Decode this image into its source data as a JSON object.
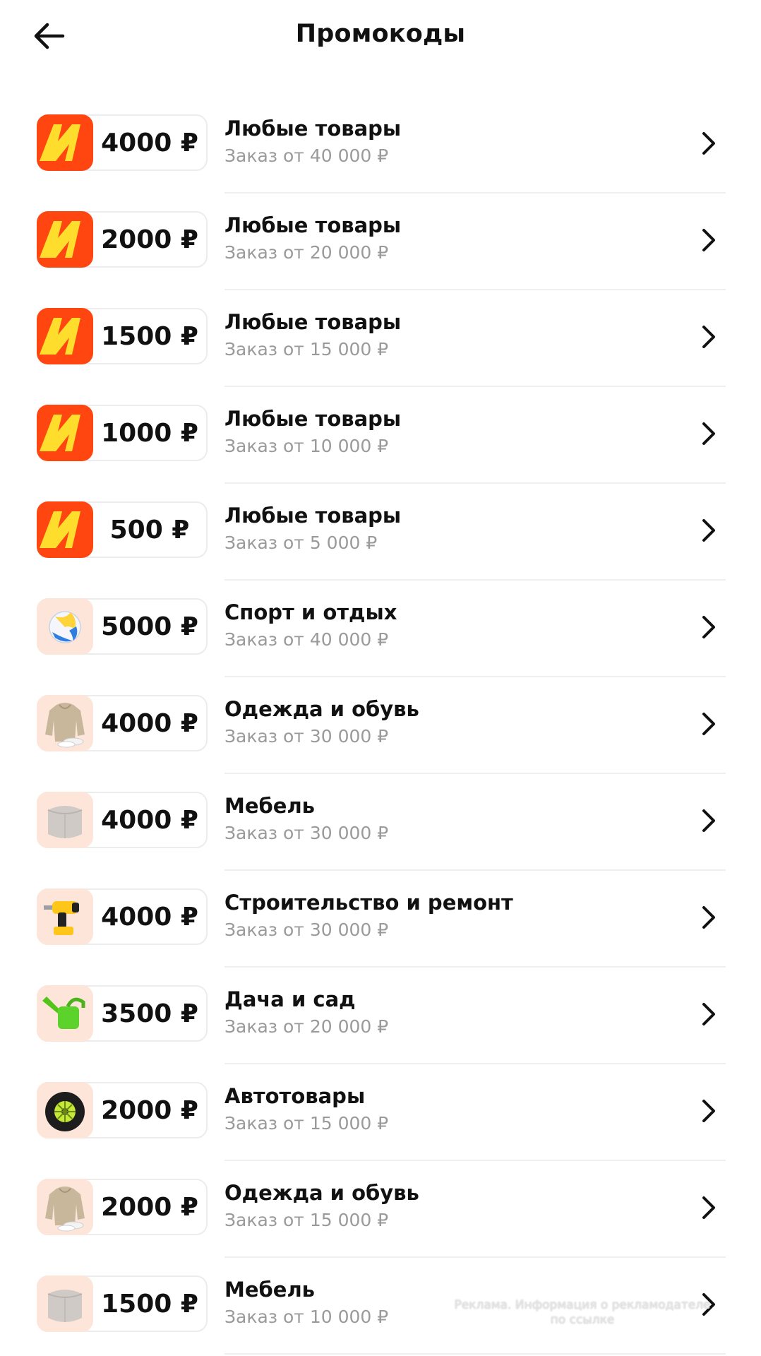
{
  "header": {
    "title": "Промокоды",
    "back_icon": "arrow-left-icon"
  },
  "colors": {
    "brand_red": "#ff4611",
    "brand_yellow": "#ffdd2d",
    "subtext": "#9a9a9a",
    "thumb_peach": "#fde6d9"
  },
  "promos": [
    {
      "amount": "4000 ₽",
      "category": "Любые товары",
      "condition": "Заказ от 40 000 ₽",
      "icon": "market-logo-icon"
    },
    {
      "amount": "2000 ₽",
      "category": "Любые товары",
      "condition": "Заказ от 20 000 ₽",
      "icon": "market-logo-icon"
    },
    {
      "amount": "1500 ₽",
      "category": "Любые товары",
      "condition": "Заказ от 15 000 ₽",
      "icon": "market-logo-icon"
    },
    {
      "amount": "1000 ₽",
      "category": "Любые товары",
      "condition": "Заказ от 10 000 ₽",
      "icon": "market-logo-icon"
    },
    {
      "amount": "500 ₽",
      "category": "Любые товары",
      "condition": "Заказ от 5 000 ₽",
      "icon": "market-logo-icon"
    },
    {
      "amount": "5000 ₽",
      "category": "Спорт и отдых",
      "condition": "Заказ от 40 000 ₽",
      "icon": "volleyball-icon"
    },
    {
      "amount": "4000 ₽",
      "category": "Одежда и обувь",
      "condition": "Заказ от 30 000 ₽",
      "icon": "hoodie-icon"
    },
    {
      "amount": "4000 ₽",
      "category": "Мебель",
      "condition": "Заказ от 30 000 ₽",
      "icon": "pouf-icon"
    },
    {
      "amount": "4000 ₽",
      "category": "Строительство и ремонт",
      "condition": "Заказ от 30 000 ₽",
      "icon": "drill-icon"
    },
    {
      "amount": "3500 ₽",
      "category": "Дача и сад",
      "condition": "Заказ от 20 000 ₽",
      "icon": "watering-can-icon"
    },
    {
      "amount": "2000 ₽",
      "category": "Автотовары",
      "condition": "Заказ от 15 000 ₽",
      "icon": "tire-icon"
    },
    {
      "amount": "2000 ₽",
      "category": "Одежда и обувь",
      "condition": "Заказ от 15 000 ₽",
      "icon": "hoodie-icon"
    },
    {
      "amount": "1500 ₽",
      "category": "Мебель",
      "condition": "Заказ от 10 000 ₽",
      "icon": "pouf-icon"
    }
  ],
  "ad_note": "Реклама. Информация о рекламодателе по ссылке"
}
